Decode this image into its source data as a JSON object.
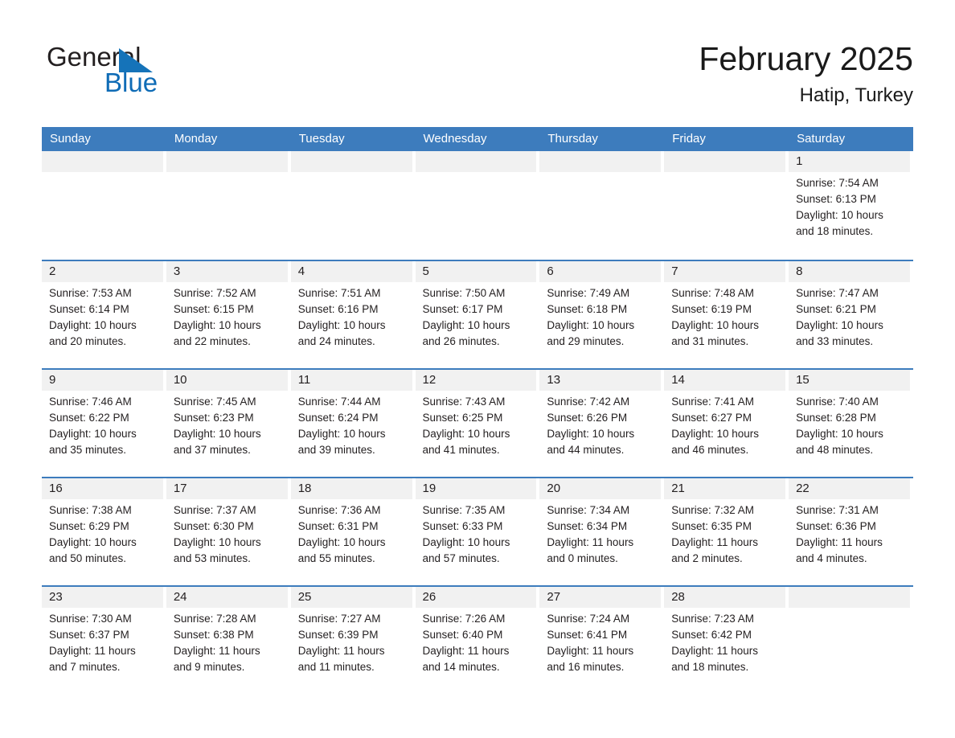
{
  "brand": {
    "name_part1": "General",
    "name_part2": "Blue",
    "triangle_icon": "triangle-icon",
    "accent_color": "#0f6cb6"
  },
  "header": {
    "title": "February 2025",
    "location": "Hatip, Turkey"
  },
  "theme": {
    "header_blue": "#3d7cbd",
    "day_strip_gray": "#f1f1f1",
    "text": "#231f20"
  },
  "weekdays": [
    "Sunday",
    "Monday",
    "Tuesday",
    "Wednesday",
    "Thursday",
    "Friday",
    "Saturday"
  ],
  "weeks": [
    [
      {
        "day": "",
        "sunrise": "",
        "sunset": "",
        "daylight1": "",
        "daylight2": ""
      },
      {
        "day": "",
        "sunrise": "",
        "sunset": "",
        "daylight1": "",
        "daylight2": ""
      },
      {
        "day": "",
        "sunrise": "",
        "sunset": "",
        "daylight1": "",
        "daylight2": ""
      },
      {
        "day": "",
        "sunrise": "",
        "sunset": "",
        "daylight1": "",
        "daylight2": ""
      },
      {
        "day": "",
        "sunrise": "",
        "sunset": "",
        "daylight1": "",
        "daylight2": ""
      },
      {
        "day": "",
        "sunrise": "",
        "sunset": "",
        "daylight1": "",
        "daylight2": ""
      },
      {
        "day": "1",
        "sunrise": "Sunrise: 7:54 AM",
        "sunset": "Sunset: 6:13 PM",
        "daylight1": "Daylight: 10 hours",
        "daylight2": "and 18 minutes."
      }
    ],
    [
      {
        "day": "2",
        "sunrise": "Sunrise: 7:53 AM",
        "sunset": "Sunset: 6:14 PM",
        "daylight1": "Daylight: 10 hours",
        "daylight2": "and 20 minutes."
      },
      {
        "day": "3",
        "sunrise": "Sunrise: 7:52 AM",
        "sunset": "Sunset: 6:15 PM",
        "daylight1": "Daylight: 10 hours",
        "daylight2": "and 22 minutes."
      },
      {
        "day": "4",
        "sunrise": "Sunrise: 7:51 AM",
        "sunset": "Sunset: 6:16 PM",
        "daylight1": "Daylight: 10 hours",
        "daylight2": "and 24 minutes."
      },
      {
        "day": "5",
        "sunrise": "Sunrise: 7:50 AM",
        "sunset": "Sunset: 6:17 PM",
        "daylight1": "Daylight: 10 hours",
        "daylight2": "and 26 minutes."
      },
      {
        "day": "6",
        "sunrise": "Sunrise: 7:49 AM",
        "sunset": "Sunset: 6:18 PM",
        "daylight1": "Daylight: 10 hours",
        "daylight2": "and 29 minutes."
      },
      {
        "day": "7",
        "sunrise": "Sunrise: 7:48 AM",
        "sunset": "Sunset: 6:19 PM",
        "daylight1": "Daylight: 10 hours",
        "daylight2": "and 31 minutes."
      },
      {
        "day": "8",
        "sunrise": "Sunrise: 7:47 AM",
        "sunset": "Sunset: 6:21 PM",
        "daylight1": "Daylight: 10 hours",
        "daylight2": "and 33 minutes."
      }
    ],
    [
      {
        "day": "9",
        "sunrise": "Sunrise: 7:46 AM",
        "sunset": "Sunset: 6:22 PM",
        "daylight1": "Daylight: 10 hours",
        "daylight2": "and 35 minutes."
      },
      {
        "day": "10",
        "sunrise": "Sunrise: 7:45 AM",
        "sunset": "Sunset: 6:23 PM",
        "daylight1": "Daylight: 10 hours",
        "daylight2": "and 37 minutes."
      },
      {
        "day": "11",
        "sunrise": "Sunrise: 7:44 AM",
        "sunset": "Sunset: 6:24 PM",
        "daylight1": "Daylight: 10 hours",
        "daylight2": "and 39 minutes."
      },
      {
        "day": "12",
        "sunrise": "Sunrise: 7:43 AM",
        "sunset": "Sunset: 6:25 PM",
        "daylight1": "Daylight: 10 hours",
        "daylight2": "and 41 minutes."
      },
      {
        "day": "13",
        "sunrise": "Sunrise: 7:42 AM",
        "sunset": "Sunset: 6:26 PM",
        "daylight1": "Daylight: 10 hours",
        "daylight2": "and 44 minutes."
      },
      {
        "day": "14",
        "sunrise": "Sunrise: 7:41 AM",
        "sunset": "Sunset: 6:27 PM",
        "daylight1": "Daylight: 10 hours",
        "daylight2": "and 46 minutes."
      },
      {
        "day": "15",
        "sunrise": "Sunrise: 7:40 AM",
        "sunset": "Sunset: 6:28 PM",
        "daylight1": "Daylight: 10 hours",
        "daylight2": "and 48 minutes."
      }
    ],
    [
      {
        "day": "16",
        "sunrise": "Sunrise: 7:38 AM",
        "sunset": "Sunset: 6:29 PM",
        "daylight1": "Daylight: 10 hours",
        "daylight2": "and 50 minutes."
      },
      {
        "day": "17",
        "sunrise": "Sunrise: 7:37 AM",
        "sunset": "Sunset: 6:30 PM",
        "daylight1": "Daylight: 10 hours",
        "daylight2": "and 53 minutes."
      },
      {
        "day": "18",
        "sunrise": "Sunrise: 7:36 AM",
        "sunset": "Sunset: 6:31 PM",
        "daylight1": "Daylight: 10 hours",
        "daylight2": "and 55 minutes."
      },
      {
        "day": "19",
        "sunrise": "Sunrise: 7:35 AM",
        "sunset": "Sunset: 6:33 PM",
        "daylight1": "Daylight: 10 hours",
        "daylight2": "and 57 minutes."
      },
      {
        "day": "20",
        "sunrise": "Sunrise: 7:34 AM",
        "sunset": "Sunset: 6:34 PM",
        "daylight1": "Daylight: 11 hours",
        "daylight2": "and 0 minutes."
      },
      {
        "day": "21",
        "sunrise": "Sunrise: 7:32 AM",
        "sunset": "Sunset: 6:35 PM",
        "daylight1": "Daylight: 11 hours",
        "daylight2": "and 2 minutes."
      },
      {
        "day": "22",
        "sunrise": "Sunrise: 7:31 AM",
        "sunset": "Sunset: 6:36 PM",
        "daylight1": "Daylight: 11 hours",
        "daylight2": "and 4 minutes."
      }
    ],
    [
      {
        "day": "23",
        "sunrise": "Sunrise: 7:30 AM",
        "sunset": "Sunset: 6:37 PM",
        "daylight1": "Daylight: 11 hours",
        "daylight2": "and 7 minutes."
      },
      {
        "day": "24",
        "sunrise": "Sunrise: 7:28 AM",
        "sunset": "Sunset: 6:38 PM",
        "daylight1": "Daylight: 11 hours",
        "daylight2": "and 9 minutes."
      },
      {
        "day": "25",
        "sunrise": "Sunrise: 7:27 AM",
        "sunset": "Sunset: 6:39 PM",
        "daylight1": "Daylight: 11 hours",
        "daylight2": "and 11 minutes."
      },
      {
        "day": "26",
        "sunrise": "Sunrise: 7:26 AM",
        "sunset": "Sunset: 6:40 PM",
        "daylight1": "Daylight: 11 hours",
        "daylight2": "and 14 minutes."
      },
      {
        "day": "27",
        "sunrise": "Sunrise: 7:24 AM",
        "sunset": "Sunset: 6:41 PM",
        "daylight1": "Daylight: 11 hours",
        "daylight2": "and 16 minutes."
      },
      {
        "day": "28",
        "sunrise": "Sunrise: 7:23 AM",
        "sunset": "Sunset: 6:42 PM",
        "daylight1": "Daylight: 11 hours",
        "daylight2": "and 18 minutes."
      },
      {
        "day": "",
        "sunrise": "",
        "sunset": "",
        "daylight1": "",
        "daylight2": ""
      }
    ]
  ]
}
